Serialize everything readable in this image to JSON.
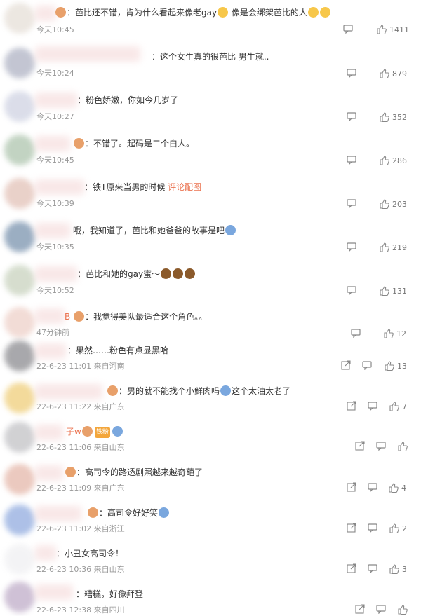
{
  "comments": [
    {
      "parts": [
        "：芭比还不错，肯为什么看起来像老gay",
        "像是会绑架芭比的人"
      ],
      "time": "今天10:45",
      "likes": "1411",
      "avatar": "#e9e3dc"
    },
    {
      "parts": [
        "：这个女生真的很芭比 男生就.."
      ],
      "time": "今天10:24",
      "likes": "879",
      "avatar": "#b9bccb"
    },
    {
      "parts": [
        "：粉色娇嫩，你如今几岁了"
      ],
      "time": "今天10:27",
      "likes": "352",
      "avatar": "#d5d8e6"
    },
    {
      "parts": [
        "：不错了。起码是二个白人。"
      ],
      "time": "今天10:45",
      "likes": "286",
      "avatar": "#b8ccb8"
    },
    {
      "parts": [
        "：铁T原来当男的时候",
        "评论配图"
      ],
      "time": "今天10:39",
      "likes": "203",
      "avatar": "#e6c9c0"
    },
    {
      "parts": [
        "哦，我知道了，芭比和她爸爸的故事是吧"
      ],
      "time": "今天10:35",
      "likes": "219",
      "avatar": "#8aa0b8"
    },
    {
      "parts": [
        "：芭比和她的gay蜜～"
      ],
      "time": "今天10:52",
      "likes": "131",
      "avatar": "#cfd8c6"
    },
    {
      "parts": [
        "B",
        "：我觉得美队最适合这个角色。。"
      ],
      "time": "47分钟前",
      "likes": "12",
      "avatar": "#f0d6cf"
    },
    {
      "parts": [
        "：果然……粉色有点显黑哈"
      ],
      "time": "22-6-23 11:01 来自河南",
      "likes": "13",
      "avatar": "#9a9a9e"
    },
    {
      "parts": [
        "：男的就不能找个小鲜肉吗",
        "这个太油太老了"
      ],
      "time": "22-6-23 11:22 来自广东",
      "likes": "7",
      "avatar": "#f1d48a"
    },
    {
      "parts": [
        "子w",
        "铁粉"
      ],
      "time": "22-6-23 11:06 来自山东",
      "likes": "",
      "avatar": "#c9c9cc"
    },
    {
      "parts": [
        "：高司令的路透剧照越来越奇葩了"
      ],
      "time": "22-6-23 11:09 来自广东",
      "likes": "4",
      "avatar": "#e8c0b4"
    },
    {
      "parts": [
        "：高司令好好笑"
      ],
      "time": "22-6-23 11:02 来自浙江",
      "likes": "2",
      "avatar": "#9fb6e3"
    },
    {
      "parts": [
        "：小丑女高司令！"
      ],
      "time": "22-6-23 10:36 来自山东",
      "likes": "3",
      "avatar": "#f2f2f4"
    },
    {
      "parts": [
        "：糟糕，好像拜登"
      ],
      "time": "22-6-23 12:38 来自四川",
      "likes": "",
      "avatar": "#c7b7cf"
    }
  ],
  "colors": {
    "link": "#eb7350",
    "meta": "#999999",
    "text": "#333333"
  }
}
